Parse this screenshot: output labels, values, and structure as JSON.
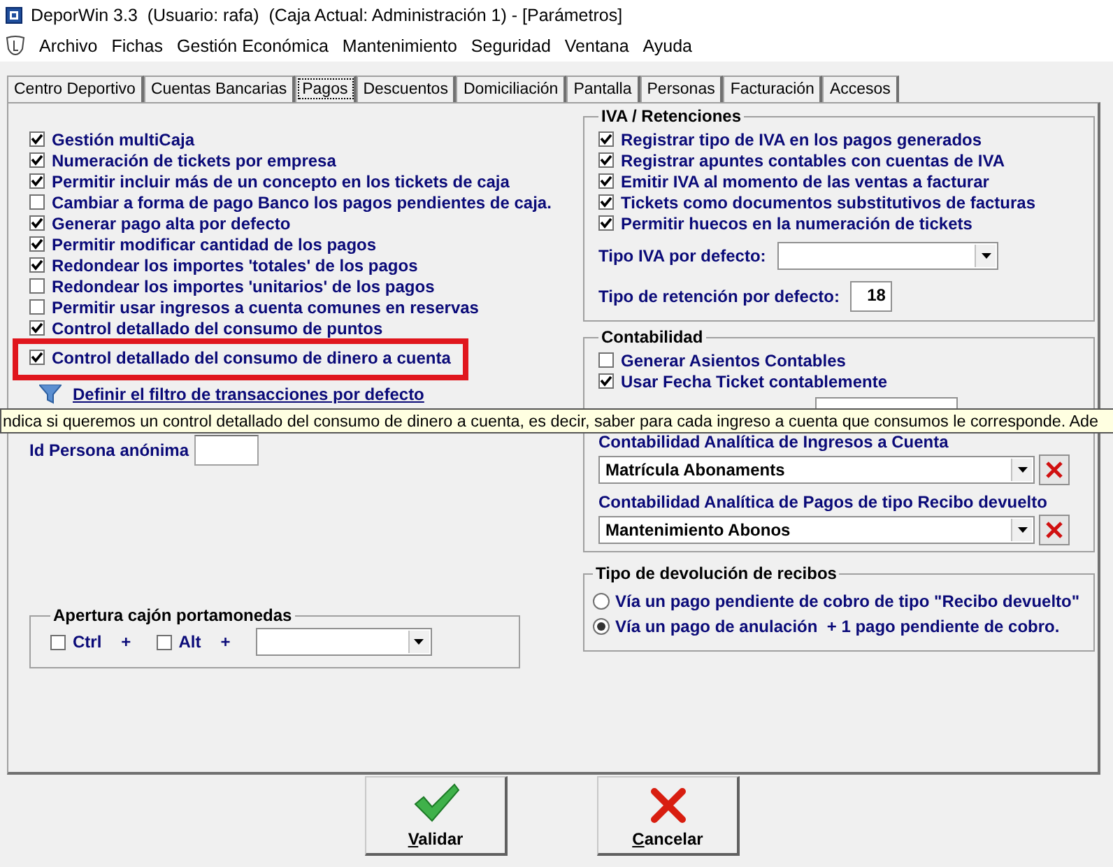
{
  "window": {
    "title": "DeporWin 3.3  (Usuario: rafa)  (Caja Actual: Administración 1) - [Parámetros]"
  },
  "menu": [
    "Archivo",
    "Fichas",
    "Gestión Económica",
    "Mantenimiento",
    "Seguridad",
    "Ventana",
    "Ayuda"
  ],
  "tabs": [
    {
      "label": "Centro Deportivo",
      "selected": false
    },
    {
      "label": "Cuentas Bancarias",
      "selected": false
    },
    {
      "label": "Pagos",
      "selected": true
    },
    {
      "label": "Descuentos",
      "selected": false
    },
    {
      "label": "Domiciliación",
      "selected": false
    },
    {
      "label": "Pantalla",
      "selected": false
    },
    {
      "label": "Personas",
      "selected": false
    },
    {
      "label": "Facturación",
      "selected": false
    },
    {
      "label": "Accesos",
      "selected": false
    }
  ],
  "payment_options": [
    {
      "label": "Gestión multiCaja",
      "checked": true,
      "highlighted": false
    },
    {
      "label": "Numeración de tickets por empresa",
      "checked": true,
      "highlighted": false
    },
    {
      "label": "Permitir incluir más de un concepto en los tickets de caja",
      "checked": true,
      "highlighted": false
    },
    {
      "label": "Cambiar a forma de pago Banco los pagos pendientes de caja.",
      "checked": false,
      "highlighted": false
    },
    {
      "label": "Generar pago alta por defecto",
      "checked": true,
      "highlighted": false
    },
    {
      "label": "Permitir modificar cantidad de los pagos",
      "checked": true,
      "highlighted": false
    },
    {
      "label": "Redondear los importes 'totales' de los pagos",
      "checked": true,
      "highlighted": false
    },
    {
      "label": "Redondear los importes 'unitarios' de los pagos",
      "checked": false,
      "highlighted": false
    },
    {
      "label": "Permitir usar ingresos a cuenta comunes en reservas",
      "checked": false,
      "highlighted": false
    },
    {
      "label": "Control detallado del consumo de puntos",
      "checked": true,
      "highlighted": false
    },
    {
      "label": "Control detallado del consumo de dinero a cuenta",
      "checked": true,
      "highlighted": true
    }
  ],
  "filter_link": "Definir el filtro de transacciones por defecto",
  "anonymous_person": {
    "label": "Id Persona anónima"
  },
  "cash_drawer": {
    "title": "Apertura cajón portamonedas",
    "keys": [
      {
        "label": "Ctrl",
        "checked": false,
        "plus": "+"
      },
      {
        "label": "Alt",
        "checked": false,
        "plus": "+"
      }
    ]
  },
  "iva": {
    "title": "IVA / Retenciones",
    "options": [
      {
        "label": "Registrar tipo de IVA en los pagos generados",
        "checked": true
      },
      {
        "label": "Registrar apuntes contables con cuentas de IVA",
        "checked": true
      },
      {
        "label": "Emitir IVA al momento de las ventas a facturar",
        "checked": true
      },
      {
        "label": "Tickets como documentos substitutivos de facturas",
        "checked": true
      },
      {
        "label": "Permitir huecos en la numeración de tickets",
        "checked": true
      }
    ],
    "default_type": {
      "label": "Tipo IVA por defecto:"
    },
    "retention": {
      "label": "Tipo de retención por defecto:",
      "value": "18"
    }
  },
  "accounting": {
    "title": "Contabilidad",
    "options": [
      {
        "label": "Generar Asientos Contables",
        "checked": false
      },
      {
        "label": "Usar Fecha Ticket contablemente",
        "checked": true
      }
    ],
    "analytic": [
      {
        "label": "Contabilidad Analítica de Ingresos a Cuenta",
        "value": "Matrícula Abonaments"
      },
      {
        "label": "Contabilidad Analítica de Pagos de tipo Recibo devuelto",
        "value": "Mantenimiento Abonos"
      }
    ]
  },
  "returns": {
    "title": "Tipo de devolución de recibos",
    "options": [
      {
        "label": "Vía un pago pendiente de cobro de tipo \"Recibo devuelto\"",
        "selected": false
      },
      {
        "label": "Vía un pago de anulación  + 1 pago pendiente de cobro.",
        "selected": true
      }
    ]
  },
  "tooltip": "ndica si queremos un control detallado del consumo de dinero a cuenta, es decir, saber para cada ingreso a cuenta que consumos le corresponde. Ade",
  "buttons": [
    {
      "label": "Validar",
      "kind": "ok"
    },
    {
      "label": "Cancelar",
      "kind": "cancel"
    }
  ]
}
